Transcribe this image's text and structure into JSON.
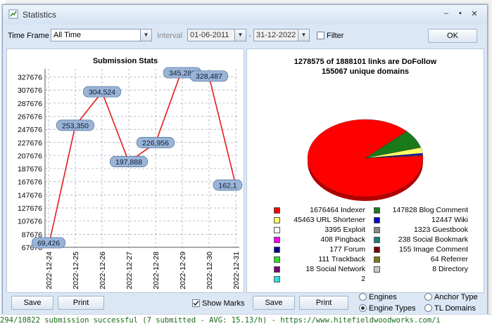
{
  "window": {
    "title": "Statistics"
  },
  "filters": {
    "time_frame_label": "Time Frame",
    "time_frame_value": "All Time",
    "interval_label": "Interval",
    "date_from": "01-06-2011",
    "date_to": "31-12-2022",
    "filter_label": "Filter",
    "ok_label": "OK"
  },
  "left_chart": {
    "title": "Submission Stats",
    "y_ticks": [
      "327676",
      "307676",
      "287676",
      "267676",
      "247676",
      "227676",
      "207676",
      "187676",
      "167676",
      "147676",
      "127676",
      "107676",
      "87676",
      "67676"
    ],
    "point_labels": [
      "69,426",
      "253,350",
      "304,524",
      "197,888",
      "226,956",
      "345,288",
      "328,487",
      "162,1"
    ]
  },
  "chart_data": [
    {
      "type": "line",
      "title": "Submission Stats",
      "x": [
        "2022-12-24",
        "2022-12-25",
        "2022-12-26",
        "2022-12-27",
        "2022-12-28",
        "2022-12-29",
        "2022-12-30",
        "2022-12-31"
      ],
      "series": [
        {
          "values": [
            69426,
            253350,
            304524,
            197888,
            226956,
            345288,
            328487,
            162100
          ]
        }
      ],
      "ylim": [
        67676,
        340000
      ],
      "grid": true,
      "line_color": "#e81a1a"
    },
    {
      "type": "pie",
      "title": "1278575 of 1888101 links are DoFollow",
      "subtitle": "155067 unique domains",
      "categories": [
        "Indexer",
        "Blog Comment",
        "URL Shortener",
        "Wiki",
        "Exploit",
        "Guestbook",
        "Pingback",
        "Social Bookmark",
        "Forum",
        "Image Comment",
        "Trackback",
        "Referrer",
        "Social Network",
        "Directory",
        ""
      ],
      "values": [
        1676464,
        147828,
        45463,
        12447,
        3395,
        1323,
        408,
        238,
        177,
        155,
        111,
        64,
        18,
        8,
        2
      ],
      "colors": [
        "#ff0000",
        "#1a7a1a",
        "#ffff66",
        "#0000c8",
        "#ffffff",
        "#888888",
        "#ff00ff",
        "#1c7a7a",
        "#000090",
        "#7a0000",
        "#33dd33",
        "#7a7a1a",
        "#7a007a",
        "#c8c8c8",
        "#33dddd"
      ]
    }
  ],
  "right_chart": {
    "title": "1278575 of 1888101 links are DoFollow",
    "subtitle": "155067 unique domains"
  },
  "legend": [
    {
      "label": "1676464 Indexer",
      "color": "#ff0000"
    },
    {
      "label": "147828 Blog Comment",
      "color": "#1a7a1a"
    },
    {
      "label": "45463 URL Shortener",
      "color": "#ffff66"
    },
    {
      "label": "12447 Wiki",
      "color": "#0000c8"
    },
    {
      "label": "3395 Exploit",
      "color": "#ffffff"
    },
    {
      "label": "1323 Guestbook",
      "color": "#888888"
    },
    {
      "label": "408 Pingback",
      "color": "#ff00ff"
    },
    {
      "label": "238 Social Bookmark",
      "color": "#1c7a7a"
    },
    {
      "label": "177 Forum",
      "color": "#000090"
    },
    {
      "label": "155 Image Comment",
      "color": "#7a0000"
    },
    {
      "label": "111 Trackback",
      "color": "#33dd33"
    },
    {
      "label": "64 Referrer",
      "color": "#7a7a1a"
    },
    {
      "label": "18 Social Network",
      "color": "#7a007a"
    },
    {
      "label": "8 Directory",
      "color": "#c8c8c8"
    },
    {
      "label": "2",
      "color": "#33dddd"
    }
  ],
  "bottom": {
    "save_left": "Save",
    "print_left": "Print",
    "show_marks": "Show Marks",
    "save_right": "Save",
    "print_right": "Print",
    "radio_engines": "Engines",
    "radio_engine_types": "Engine Types",
    "radio_anchor_type": "Anchor Type",
    "radio_tl_domains": "TL Domains"
  },
  "status": {
    "text": "294/10822 submission successful (7 submitted - AVG: 15.13/h) - https://www.hitefieldwoodworks.com/i"
  }
}
